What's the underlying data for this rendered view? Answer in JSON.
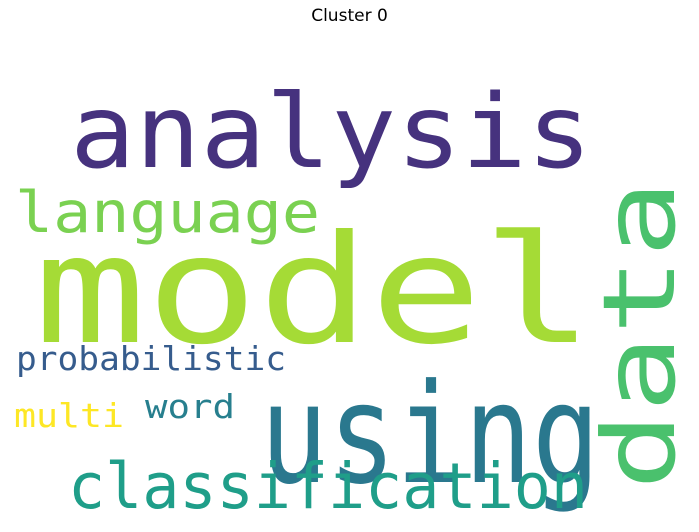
{
  "title": "Cluster 0",
  "words": [
    {
      "text": "model",
      "color": "#a5db36"
    },
    {
      "text": "analysis",
      "color": "#46327e"
    },
    {
      "text": "using",
      "color": "#2a788e"
    },
    {
      "text": "data",
      "color": "#4ac16d"
    },
    {
      "text": "language",
      "color": "#7ad151"
    },
    {
      "text": "classification",
      "color": "#1f9e89"
    },
    {
      "text": "probabilistic",
      "color": "#365c8d"
    },
    {
      "text": "word",
      "color": "#277f8e"
    },
    {
      "text": "multi",
      "color": "#fde725"
    }
  ]
}
